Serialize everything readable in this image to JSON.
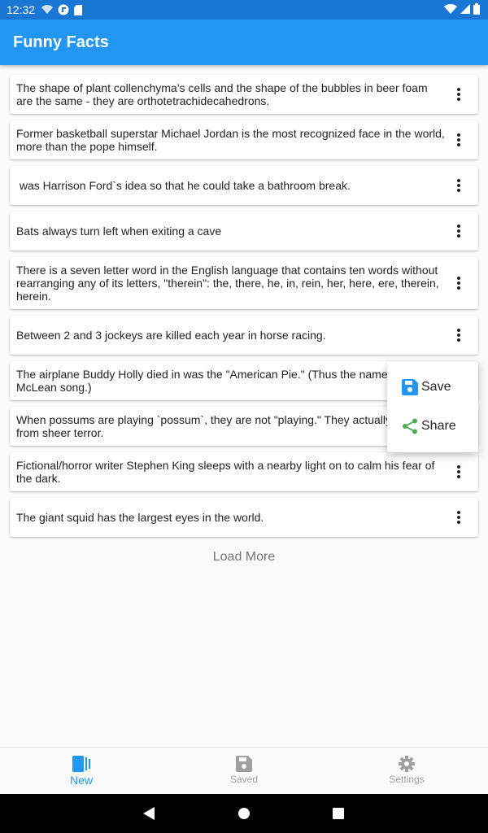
{
  "status_bar": {
    "time": "12:32"
  },
  "app_bar": {
    "title": "Funny Facts"
  },
  "facts": [
    "The shape of plant collenchyma’s cells and the shape of the bubbles in beer foam are the same - they are orthotetrachidecahedrons.",
    "Former basketball superstar Michael Jordan is the most recognized face in the world, more than the pope himself.",
    " was Harrison Ford`s idea so that he could take a bathroom break.",
    "Bats always turn left when exiting a cave",
    "There is a seven letter word in the English language that contains ten words without rearranging any of its letters, \"therein\": the, there, he, in, rein, her, here, ere, therein, herein.",
    "Between 2 and 3 jockeys are killed each year in horse racing.",
    "The airplane Buddy Holly died in was the \"American Pie.\" (Thus the name of the Don McLean song.)",
    "When possums are playing `possum`, they are not \"playing.\" They actually pass out from sheer terror.",
    "Fictional/horror writer Stephen King sleeps with a nearby light on to calm his fear of the dark.",
    "The giant squid has the largest eyes in the world."
  ],
  "load_more": "Load More",
  "popup_menu": {
    "save": "Save",
    "share": "Share"
  },
  "bottom_nav": {
    "new": "New",
    "saved": "Saved",
    "settings": "Settings"
  },
  "colors": {
    "primary": "#2196f3",
    "status_bar": "#1976d2",
    "share_icon": "#4caf50",
    "inactive": "#9e9e9e"
  }
}
